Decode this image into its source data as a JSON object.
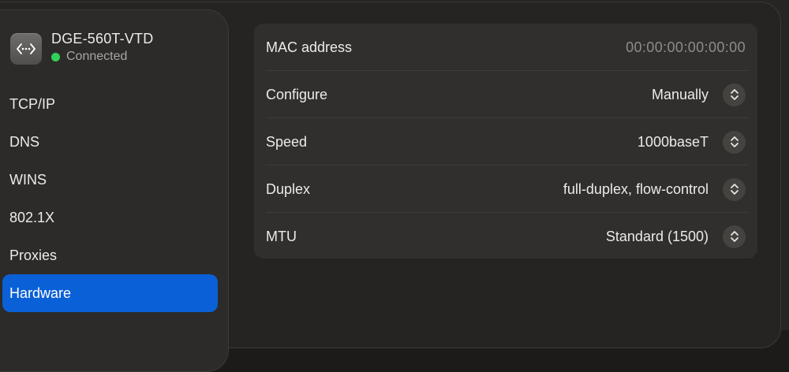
{
  "device": {
    "name": "DGE-560T-VTD",
    "status": "Connected",
    "icon": "ethernet-icon",
    "status_color": "#30d158"
  },
  "sidebar": {
    "items": [
      {
        "label": "TCP/IP",
        "active": false
      },
      {
        "label": "DNS",
        "active": false
      },
      {
        "label": "WINS",
        "active": false
      },
      {
        "label": "802.1X",
        "active": false
      },
      {
        "label": "Proxies",
        "active": false
      },
      {
        "label": "Hardware",
        "active": true
      }
    ],
    "accent_color": "#0a60d6"
  },
  "hardware": {
    "mac": {
      "label": "MAC address",
      "value": "00:00:00:00:00:00"
    },
    "configure": {
      "label": "Configure",
      "value": "Manually"
    },
    "speed": {
      "label": "Speed",
      "value": "1000baseT"
    },
    "duplex": {
      "label": "Duplex",
      "value": "full-duplex, flow-control"
    },
    "mtu": {
      "label": "MTU",
      "value": "Standard (1500)"
    }
  }
}
